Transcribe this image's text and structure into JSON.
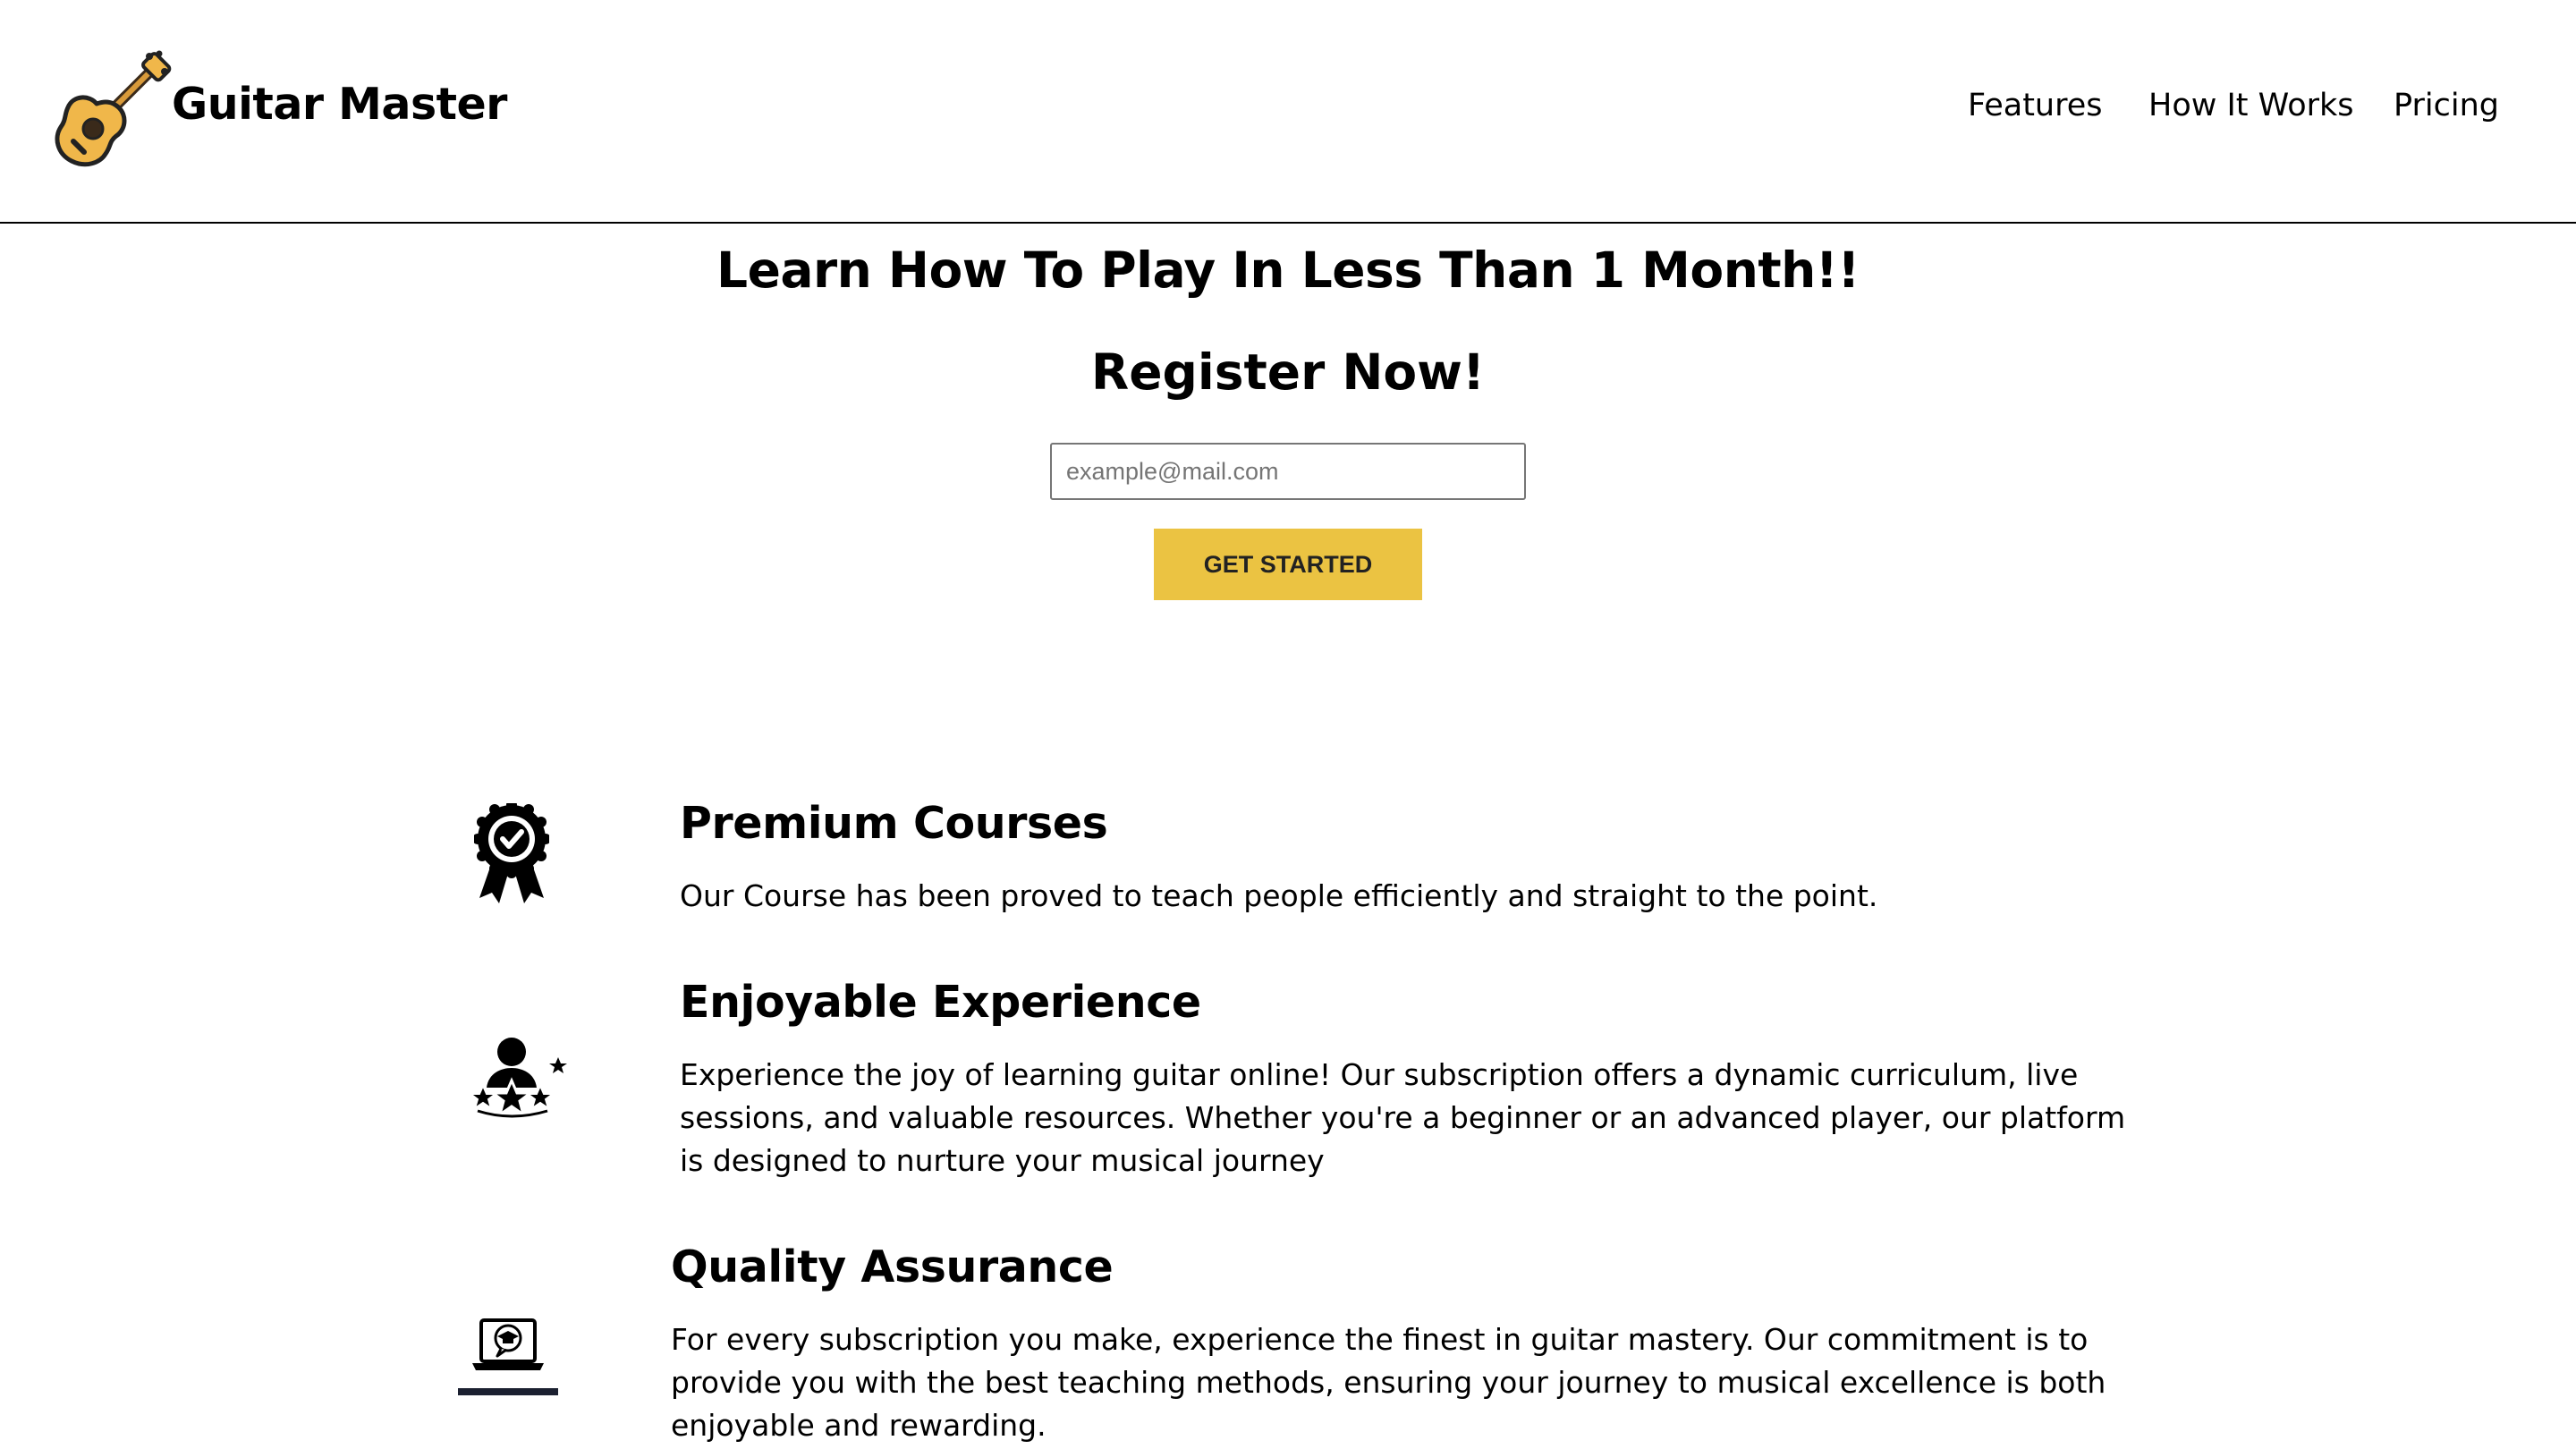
{
  "header": {
    "brand": "Guitar Master",
    "logo_icon": "guitar-icon",
    "nav": [
      {
        "label": "Features"
      },
      {
        "label": "How It Works"
      },
      {
        "label": "Pricing"
      }
    ]
  },
  "hero": {
    "title": "Learn How To Play In Less Than 1 Month!!",
    "subtitle": "Register Now!",
    "email_placeholder": "example@mail.com",
    "cta_label": "GET STARTED"
  },
  "features": [
    {
      "icon": "award-ribbon-icon",
      "title": "Premium Courses",
      "text": "Our Course has been proved to teach people efficiently and straight to the point."
    },
    {
      "icon": "person-stars-icon",
      "title": "Enjoyable Experience",
      "text": "Experience the joy of learning guitar online! Our subscription offers a dynamic curriculum, live sessions, and valuable resources. Whether you're a beginner or an advanced player, our platform is designed to nurture your musical journey"
    },
    {
      "icon": "laptop-graduation-icon",
      "title": "Quality Assurance",
      "text": "For every subscription you make, experience the finest in guitar mastery. Our commitment is to provide you with the best teaching methods, ensuring your journey to musical excellence is both enjoyable and rewarding."
    }
  ],
  "colors": {
    "accent": "#ebc342",
    "guitar_body": "#f0b74a",
    "text": "#000000"
  }
}
